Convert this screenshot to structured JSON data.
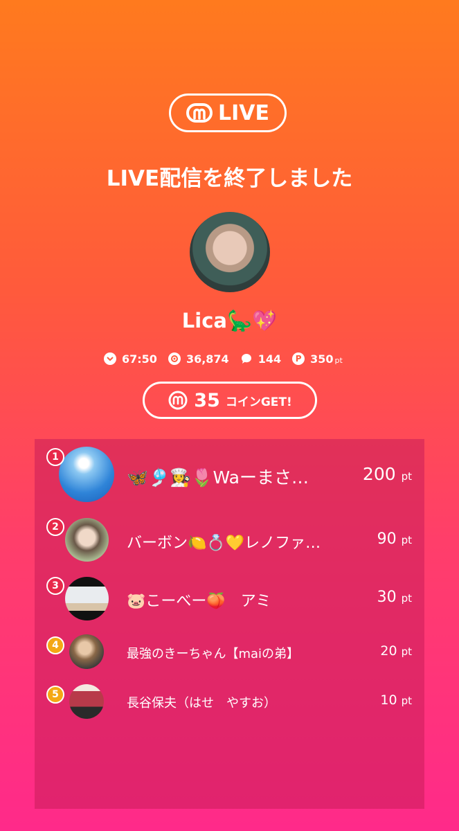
{
  "brand": {
    "logo_text": "LIVE"
  },
  "title": "LIVE配信を終了しました",
  "streamer": {
    "name": "Lica🦕💖"
  },
  "stats": {
    "duration": "67:50",
    "viewers": "36,874",
    "comments": "144",
    "points": "350",
    "points_unit": "pt"
  },
  "coins": {
    "count": "35",
    "suffix": "コインGET!"
  },
  "ranking": [
    {
      "rank": "1",
      "name": "🦋🎐👩‍🍳🌷Waーまさ…",
      "score": "200",
      "unit": "pt"
    },
    {
      "rank": "2",
      "name": "バーボン🍋💍💛レノファ…",
      "score": "90",
      "unit": "pt"
    },
    {
      "rank": "3",
      "name": "🐷こーべー🍑　アミ",
      "score": "30",
      "unit": "pt"
    },
    {
      "rank": "4",
      "name": "最強のきーちゃん【maiの弟】",
      "score": "20",
      "unit": "pt"
    },
    {
      "rank": "5",
      "name": "長谷保夫（はせ　やすお）",
      "score": "10",
      "unit": "pt"
    }
  ],
  "colors": {
    "rank_top": "#e8284a",
    "rank_other": "#f4a814"
  }
}
